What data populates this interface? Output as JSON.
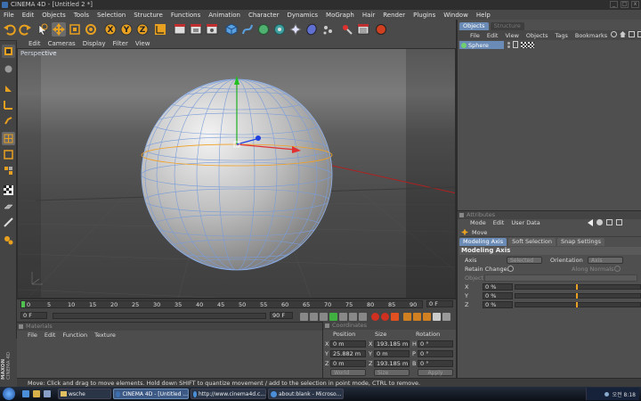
{
  "window": {
    "title": "CINEMA 4D - [Untitled 2 *]",
    "buttons": [
      "_",
      "□",
      "x"
    ]
  },
  "menubar": [
    "File",
    "Edit",
    "Objects",
    "Tools",
    "Selection",
    "Structure",
    "Functions",
    "Animation",
    "Character",
    "Dynamics",
    "MoGraph",
    "Hair",
    "Render",
    "Plugins",
    "Window",
    "Help"
  ],
  "viewport": {
    "menu": [
      "Edit",
      "Cameras",
      "Display",
      "Filter",
      "View"
    ],
    "label": "Perspective"
  },
  "timeline": {
    "ticks": [
      "0",
      "5",
      "10",
      "15",
      "20",
      "25",
      "30",
      "35",
      "40",
      "45",
      "50",
      "55",
      "60",
      "65",
      "70",
      "75",
      "80",
      "85",
      "90"
    ],
    "end_frame": "0 F",
    "current_frame": "0 F",
    "start_field": "0 F",
    "end_field": "90 F"
  },
  "materials": {
    "tab": "Materials",
    "menu": [
      "File",
      "Edit",
      "Function",
      "Texture"
    ]
  },
  "coordinates": {
    "tab": "Coordinates",
    "headers": [
      "Position",
      "Size",
      "Rotation"
    ],
    "rows": [
      {
        "axis": "X",
        "pos": "0 m",
        "size_axis": "X",
        "size": "193.185 m",
        "rot_axis": "H",
        "rot": "0 °"
      },
      {
        "axis": "Y",
        "pos": "25.882 m",
        "size_axis": "Y",
        "size": "0 m",
        "rot_axis": "P",
        "rot": "0 °"
      },
      {
        "axis": "Z",
        "pos": "0 m",
        "size_axis": "Z",
        "size": "193.185 m",
        "rot_axis": "B",
        "rot": "0 °"
      }
    ],
    "mode": "World",
    "size_mode": "Size",
    "apply": "Apply"
  },
  "objects": {
    "tabs": [
      "Objects",
      "Structure"
    ],
    "menu": [
      "File",
      "Edit",
      "View",
      "Objects",
      "Tags",
      "Bookmarks"
    ],
    "items": [
      {
        "name": "Sphere"
      }
    ]
  },
  "attributes": {
    "tab": "Attributes",
    "menu": [
      "Mode",
      "Edit",
      "User Data"
    ],
    "tool": "Move",
    "subtabs": [
      "Modeling Axis",
      "Soft Selection",
      "Snap Settings"
    ],
    "section": "Modeling Axis",
    "axis_label": "Axis",
    "axis_value": "Selected",
    "orientation_label": "Orientation",
    "orientation_value": "Axis",
    "retain_changes": "Retain Changes",
    "along_normals": "Along Normals",
    "object_label": "Object",
    "sliders": [
      {
        "axis": "X",
        "value": "0 %"
      },
      {
        "axis": "Y",
        "value": "0 %"
      },
      {
        "axis": "Z",
        "value": "0 %"
      }
    ]
  },
  "status": "Move: Click and drag to move elements. Hold down SHIFT to quantize movement / add to the selection in point mode, CTRL to remove.",
  "maxon": {
    "line1": "MAXON",
    "line2": "CINEMA 4D"
  },
  "taskbar": {
    "items": [
      "wsche",
      "CINEMA 4D - [Untitled ...",
      "http://www.cinema4d.c...",
      "about:blank - Microso..."
    ],
    "clock": "오전 8:18"
  },
  "colors": {
    "sphere_select": "#f2a020",
    "accent_orange": "#e8a020",
    "axis_x": "#e03030",
    "axis_y": "#20b020",
    "axis_z": "#2040e0",
    "selected_tab": "#6a8bb5"
  }
}
